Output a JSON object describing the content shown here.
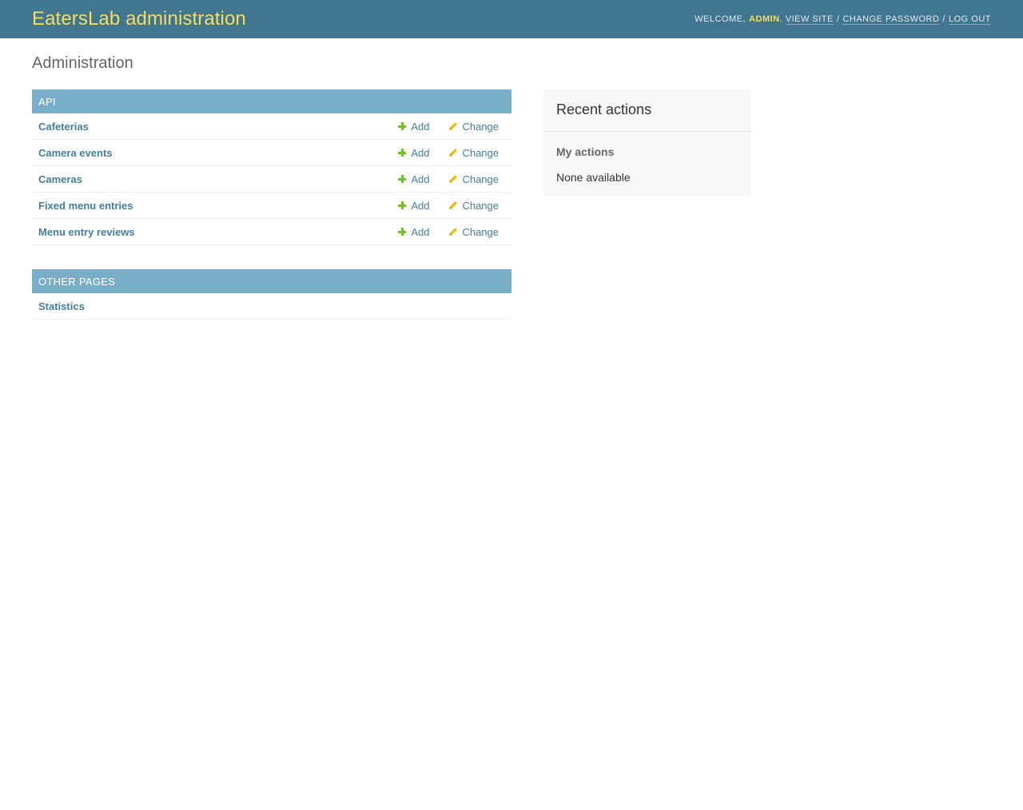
{
  "header": {
    "brand": "EatersLab administration",
    "welcome": "Welcome,",
    "username": "admin",
    "view_site": "View site",
    "change_password": "Change password",
    "log_out": "Log out",
    "sep": "/"
  },
  "page": {
    "title": "Administration"
  },
  "modules": [
    {
      "caption": "API",
      "models": [
        {
          "name": "Cafeterias",
          "add": "Add",
          "change": "Change"
        },
        {
          "name": "Camera events",
          "add": "Add",
          "change": "Change"
        },
        {
          "name": "Cameras",
          "add": "Add",
          "change": "Change"
        },
        {
          "name": "Fixed menu entries",
          "add": "Add",
          "change": "Change"
        },
        {
          "name": "Menu entry reviews",
          "add": "Add",
          "change": "Change"
        }
      ]
    },
    {
      "caption": "Other pages",
      "models": [
        {
          "name": "Statistics"
        }
      ]
    }
  ],
  "recent_actions": {
    "title": "Recent actions",
    "subtitle": "My actions",
    "empty_text": "None available"
  },
  "colors": {
    "header_bg": "#417690",
    "brand": "#f5dd5d",
    "caption_bg": "#79aec8",
    "link": "#447e9b",
    "add_icon": "#70bf2b",
    "change_icon": "#efb80b"
  },
  "icons": {
    "add": "plus-icon",
    "change": "pencil-icon"
  }
}
